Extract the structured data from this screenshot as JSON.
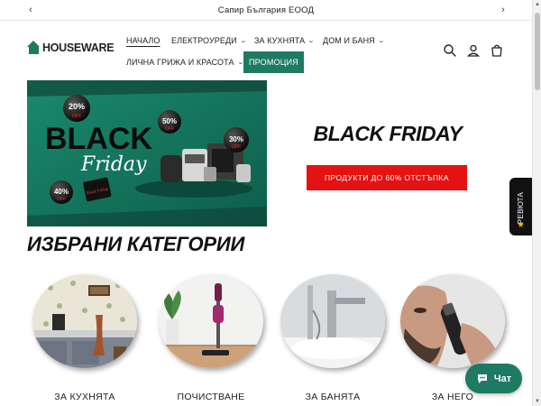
{
  "announcement": {
    "text": "Сапир България ЕООД"
  },
  "brand": {
    "logo_text": "HOUSEWARE",
    "accent": "#1e7a63"
  },
  "nav": {
    "home": "НАЧАЛО",
    "electronics": "ЕЛЕКТРОУРЕДИ",
    "kitchen": "ЗА КУХНЯТА",
    "home_bath": "ДОМ И БАНЯ",
    "personal_care": "ЛИЧНА ГРИЖА И КРАСОТА",
    "promo": "ПРОМОЦИЯ"
  },
  "header_icons": [
    "search-icon",
    "account-icon",
    "cart-icon"
  ],
  "hero": {
    "title": "BLACK FRIDAY",
    "button_label": "ПРОДУКТИ ДО 60% ОТСТЪПКА",
    "button_color": "#e41212",
    "banner": {
      "title_big": "BLACK",
      "title_script": "Friday",
      "balloons": [
        "20%",
        "50%",
        "30%",
        "40%"
      ],
      "balloon_sub": "OFF",
      "tag": "Black Friday"
    }
  },
  "reviews_tab": {
    "label": "РЕВЮТА"
  },
  "section": {
    "title": "ИЗБРАНИ КАТЕГОРИИ"
  },
  "categories": [
    {
      "name": "ЗА КУХНЯТА"
    },
    {
      "name": "ПОЧИСТВАНЕ"
    },
    {
      "name": "ЗА БАНЯТА"
    },
    {
      "name": "ЗА НЕГО"
    }
  ],
  "chat": {
    "label": "Чат"
  }
}
